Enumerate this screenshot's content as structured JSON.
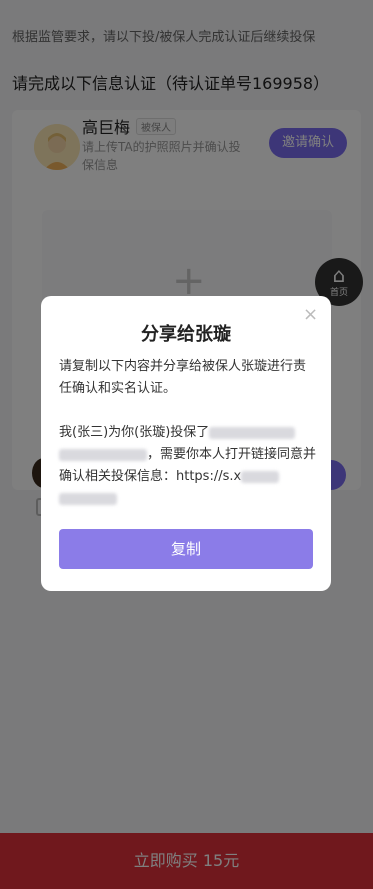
{
  "page": {
    "notice": "根据监管要求，请以下投/被保人完成认证后继续投保",
    "section_title": "请完成以下信息认证（待认证单号169958）",
    "person": {
      "name": "高巨梅",
      "tag": "被保人",
      "desc": "请上传TA的护照照片并确认投保信息",
      "invite_label": "邀请确认"
    },
    "upload_plus": "+",
    "home_label": "首页",
    "bottom_button": "立即购买 15元"
  },
  "modal": {
    "title": "分享给张璇",
    "close": "×",
    "intro": "请复制以下内容并分享给被保人张璇进行责任确认和实名认证。",
    "message_part1": "我(张三)为你(张璇)投保了",
    "message_part2": "，需要你本人打开链接同意并确认相关投保信息：https://s.x",
    "copy_label": "复制"
  },
  "colors": {
    "accent": "#7b6cf0",
    "copy_button": "#8b7ce8",
    "bottom_bar": "#e0303a"
  }
}
